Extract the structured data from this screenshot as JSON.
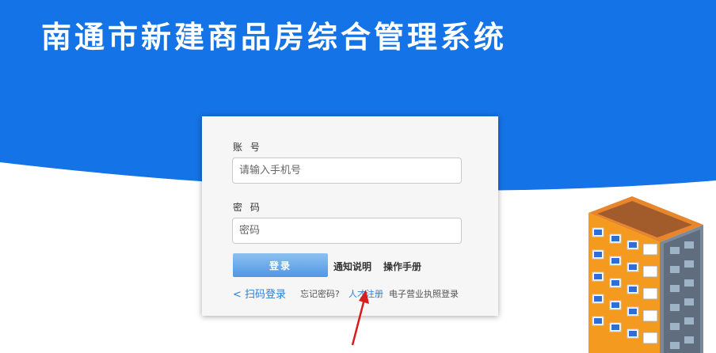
{
  "header": {
    "title": "南通市新建商品房综合管理系统"
  },
  "login": {
    "account_label": "账 号",
    "account_placeholder": "请输入手机号",
    "password_label": "密 码",
    "password_placeholder": "密码",
    "login_button": "登录",
    "notice_link": "通知说明",
    "manual_link": "操作手册",
    "qr_login": "< 扫码登录",
    "forgot_password": "忘记密码?",
    "talent_register": "人才注册",
    "license_login": "电子营业执照登录"
  },
  "colors": {
    "banner_blue": "#1473e6",
    "link_blue": "#2f7fd0",
    "button_top": "#8fc1f1",
    "button_bottom": "#4e97e4",
    "arrow_red": "#d71e1e"
  },
  "icons": {
    "building": "building-illustration",
    "annotation": "red-arrow"
  }
}
